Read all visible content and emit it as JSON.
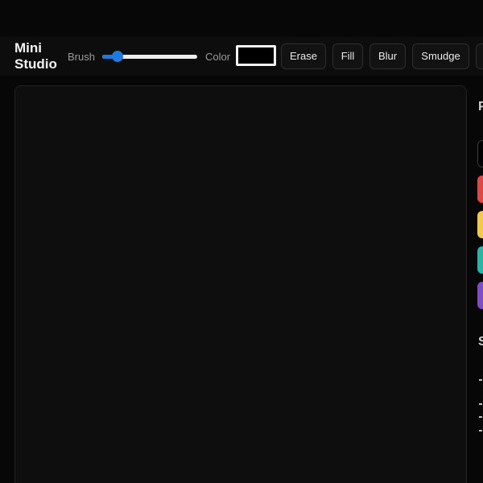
{
  "app": {
    "title_line1": "Mini",
    "title_line2": "Studio"
  },
  "toolbar": {
    "brush_label": "Brush",
    "brush_level": 0.16,
    "color_label": "Color",
    "current_color": "#000000",
    "tools": [
      "Erase",
      "Fill",
      "Blur",
      "Smudge"
    ]
  },
  "accent_color": "#1f7ae0",
  "sidebar": {
    "heading1": "P",
    "heading2": "S",
    "palette": [
      "#000000",
      "#e04848",
      "#f2c94c",
      "#2bb3a5",
      "#7e4cc4"
    ]
  }
}
